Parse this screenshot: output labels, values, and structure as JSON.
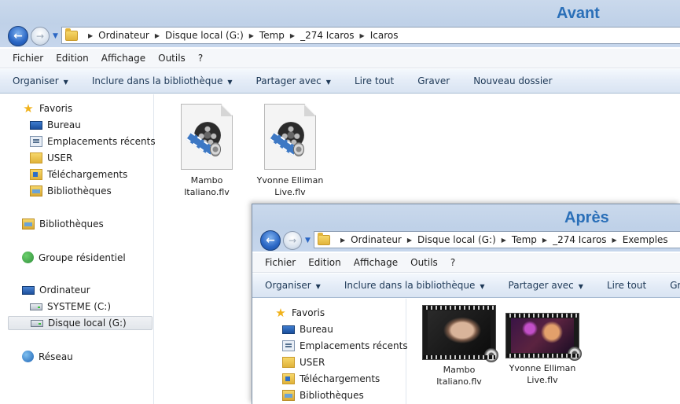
{
  "before": {
    "caption": "Avant",
    "address": [
      "Ordinateur",
      "Disque local (G:)",
      "Temp",
      "_274 Icaros",
      "Icaros"
    ],
    "menu": [
      "Fichier",
      "Edition",
      "Affichage",
      "Outils",
      "?"
    ],
    "commands": [
      "Organiser",
      "Inclure dans la bibliothèque",
      "Partager avec",
      "Lire tout",
      "Graver",
      "Nouveau dossier"
    ],
    "nav": {
      "favoris": "Favoris",
      "bureau": "Bureau",
      "emplacements": "Emplacements récents",
      "user": "USER",
      "telechargements": "Téléchargements",
      "bibliotheques_fav": "Bibliothèques",
      "bibliotheques": "Bibliothèques",
      "groupe": "Groupe résidentiel",
      "ordinateur": "Ordinateur",
      "systeme": "SYSTEME (C:)",
      "disque": "Disque local (G:)",
      "reseau": "Réseau"
    },
    "files": [
      {
        "line1": "Mambo",
        "line2": "Italiano.flv"
      },
      {
        "line1": "Yvonne Elliman",
        "line2": "Live.flv"
      }
    ]
  },
  "after": {
    "caption": "Après",
    "address": [
      "Ordinateur",
      "Disque local (G:)",
      "Temp",
      "_274 Icaros",
      "Exemples"
    ],
    "menu": [
      "Fichier",
      "Edition",
      "Affichage",
      "Outils",
      "?"
    ],
    "commands": [
      "Organiser",
      "Inclure dans la bibliothèque",
      "Partager avec",
      "Lire tout",
      "Graver"
    ],
    "nav": {
      "favoris": "Favoris",
      "bureau": "Bureau",
      "emplacements": "Emplacements récents",
      "user": "USER",
      "telechargements": "Téléchargements",
      "bibliotheques_fav": "Bibliothèques"
    },
    "files": [
      {
        "line1": "Mambo",
        "line2": "Italiano.flv"
      },
      {
        "line1": "Yvonne Elliman",
        "line2": "Live.flv"
      }
    ]
  },
  "icons": {
    "back": "back-arrow-icon",
    "forward": "forward-arrow-icon",
    "folder": "folder-icon",
    "video": "video-file-icon"
  },
  "colors": {
    "caption": "#2a6fb8",
    "titlebar": "#c6d6ec",
    "cmdbar": "#dfe8f4"
  }
}
